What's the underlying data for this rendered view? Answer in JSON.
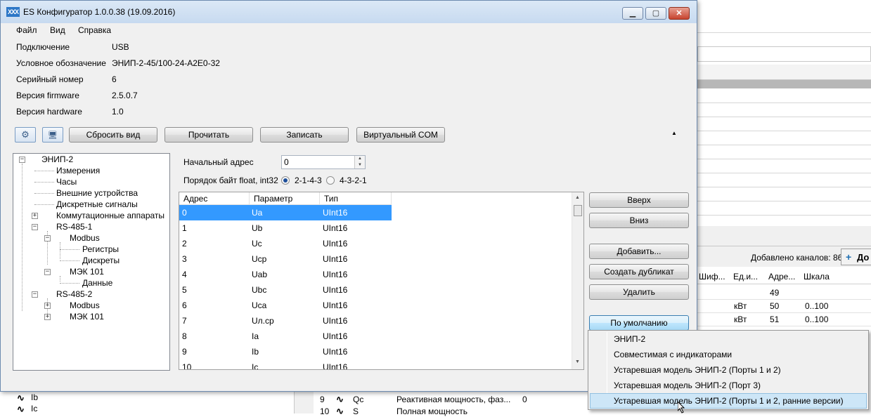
{
  "window": {
    "title": "ES Конфигуратор 1.0.0.38 (19.09.2016)",
    "app_icon": "XXX",
    "minimize_glyph": "▁",
    "maximize_glyph": "▢",
    "close_glyph": "✕"
  },
  "menu": [
    "Файл",
    "Вид",
    "Справка"
  ],
  "info": [
    {
      "label": "Подключение",
      "value": "USB"
    },
    {
      "label": "Условное обозначение",
      "value": "ЭНИП-2-45/100-24-А2Е0-32"
    },
    {
      "label": "Серийный номер",
      "value": "6"
    },
    {
      "label": "Версия firmware",
      "value": "2.5.0.7"
    },
    {
      "label": "Версия hardware",
      "value": "1.0"
    }
  ],
  "toolbar": {
    "settings_icon": "⚙",
    "monitor_icon": "🖥",
    "reset_view": "Сбросить вид",
    "read": "Прочитать",
    "write": "Записать",
    "virtual_com": "Виртуальный COM",
    "collapse_glyph": "▲"
  },
  "tree": {
    "root": "ЭНИП-2",
    "items": [
      "Измерения",
      "Часы",
      "Внешние устройства",
      "Дискретные сигналы",
      "Коммутационные аппараты",
      "RS-485-1",
      "Modbus",
      "Регистры",
      "Дискреты",
      "МЭК 101",
      "Данные",
      "RS-485-2",
      "Modbus",
      "МЭК 101"
    ],
    "expand_glyph": "+",
    "collapse_glyph": "−"
  },
  "address": {
    "label": "Начальный адрес",
    "value": "0",
    "byte_order_label": "Порядок байт float, int32",
    "option1": "2-1-4-3",
    "option2": "4-3-2-1",
    "option1_selected": true
  },
  "grid": {
    "headers": [
      "Адрес",
      "Параметр",
      "Тип"
    ],
    "rows": [
      [
        "0",
        "Ua",
        "UInt16"
      ],
      [
        "1",
        "Ub",
        "UInt16"
      ],
      [
        "2",
        "Uc",
        "UInt16"
      ],
      [
        "3",
        "Ucp",
        "UInt16"
      ],
      [
        "4",
        "Uab",
        "UInt16"
      ],
      [
        "5",
        "Ubc",
        "UInt16"
      ],
      [
        "6",
        "Uca",
        "UInt16"
      ],
      [
        "7",
        "Uл.cp",
        "UInt16"
      ],
      [
        "8",
        "Ia",
        "UInt16"
      ],
      [
        "9",
        "Ib",
        "UInt16"
      ],
      [
        "10",
        "Ic",
        "UInt16"
      ]
    ]
  },
  "side_buttons": {
    "up": "Вверх",
    "down": "Вниз",
    "add": "Добавить...",
    "duplicate": "Создать дубликат",
    "delete": "Удалить",
    "default": "По умолчанию"
  },
  "dropdown": [
    "ЭНИП-2",
    "Совместимая с индикаторами",
    "Устаревшая модель ЭНИП-2 (Порты 1 и 2)",
    "Устаревшая модель ЭНИП-2 (Порт 3)",
    "Устаревшая модель ЭНИП-2 (Порты 1 и 2, ранние версии)"
  ],
  "background": {
    "added_channels": "Добавлено каналов: 86",
    "add_button_label": "До",
    "add_button_icon": "+",
    "columns": [
      "Шиф...",
      "Ед.и...",
      "Адре...",
      "Шкала"
    ],
    "rows": [
      [
        "",
        "",
        "49",
        ""
      ],
      [
        "",
        "кВт",
        "50",
        "0..100"
      ],
      [
        "",
        "кВт",
        "51",
        "0..100"
      ]
    ],
    "left_items": [
      "Ib",
      "Ic"
    ],
    "wave_glyph": "∿",
    "bottom_row_index": "9",
    "bottom_row_name": "Qc",
    "bottom_row_desc": "Реактивная мощность, фаз...",
    "bottom_row_val": "0",
    "bottom_row2_index": "10",
    "bottom_row2_name": "S",
    "bottom_row2_desc": "Полная мощность"
  },
  "colors": {
    "selection": "#3399ff",
    "hover": "#cde6f7",
    "title_gradient": "#c7daf0"
  }
}
